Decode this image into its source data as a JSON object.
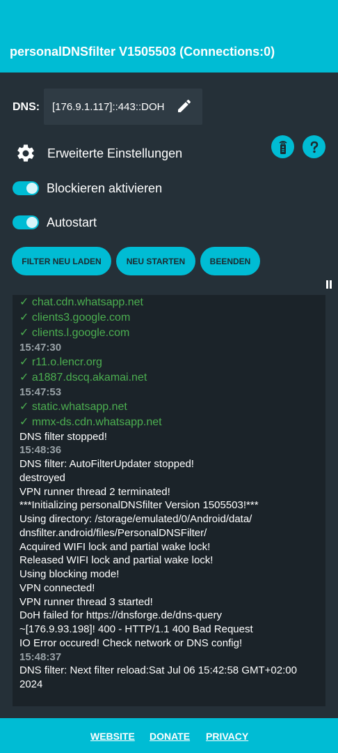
{
  "header": {
    "title": "personalDNSfilter V1505503 (Connections:0)"
  },
  "dns": {
    "label": "DNS:",
    "value": "[176.9.1.117]::443::DOH"
  },
  "settings": {
    "advanced_label": "Erweiterte Einstellungen",
    "block_label": "Blockieren aktivieren",
    "autostart_label": "Autostart"
  },
  "toggles": {
    "block_enabled": true,
    "autostart_enabled": true
  },
  "buttons": {
    "reload_filter": "FILTER NEU LADEN",
    "restart": "NEU STARTEN",
    "stop": "BEENDEN"
  },
  "log": [
    {
      "type": "ok",
      "text": "✓ chat.cdn.whatsapp.net"
    },
    {
      "type": "ok",
      "text": "✓ clients3.google.com"
    },
    {
      "type": "ok",
      "text": "✓ clients.l.google.com"
    },
    {
      "type": "ts",
      "text": "15:47:30"
    },
    {
      "type": "ok",
      "text": "✓ r11.o.lencr.org"
    },
    {
      "type": "ok",
      "text": "✓ a1887.dscq.akamai.net"
    },
    {
      "type": "ts",
      "text": "15:47:53"
    },
    {
      "type": "ok",
      "text": "✓ static.whatsapp.net"
    },
    {
      "type": "ok",
      "text": "✓ mmx-ds.cdn.whatsapp.net"
    },
    {
      "type": "msg",
      "text": "DNS filter stopped!"
    },
    {
      "type": "ts",
      "text": "15:48:36"
    },
    {
      "type": "msg",
      "text": "DNS filter: AutoFilterUpdater stopped!"
    },
    {
      "type": "msg",
      "text": "destroyed"
    },
    {
      "type": "msg",
      "text": "VPN runner thread 2 terminated!"
    },
    {
      "type": "msg",
      "text": "***Initializing personalDNSfilter Version 1505503!***"
    },
    {
      "type": "msg",
      "text": "Using directory: /storage/emulated/0/Android/data/"
    },
    {
      "type": "msg",
      "text": "dnsfilter.android/files/PersonalDNSFilter/"
    },
    {
      "type": "msg",
      "text": "Acquired WIFI lock and partial wake lock!"
    },
    {
      "type": "msg",
      "text": "Released WIFI lock and partial wake lock!"
    },
    {
      "type": "msg",
      "text": "Using blocking mode!"
    },
    {
      "type": "msg",
      "text": "VPN connected!"
    },
    {
      "type": "msg",
      "text": "VPN runner thread 3 started!"
    },
    {
      "type": "msg",
      "text": "DoH failed for https://dnsforge.de/dns-query"
    },
    {
      "type": "msg",
      "text": "~[176.9.93.198]! 400 - HTTP/1.1 400 Bad Request"
    },
    {
      "type": "msg",
      "text": "IO Error occured! Check network or DNS config!"
    },
    {
      "type": "ts",
      "text": "15:48:37"
    },
    {
      "type": "msg",
      "text": "DNS filter: Next filter reload:Sat Jul 06 15:42:58 GMT+02:00"
    },
    {
      "type": "msg",
      "text": "2024"
    }
  ],
  "footer": {
    "website": "WEBSITE",
    "donate": "DONATE",
    "privacy": "PRIVACY"
  },
  "colors": {
    "accent": "#00bcd4",
    "background": "#253038",
    "log_bg": "#1b2329",
    "ok": "#4caf50"
  },
  "icons": [
    "edit-icon",
    "gear-icon",
    "remote-icon",
    "help-icon",
    "pause-icon"
  ]
}
